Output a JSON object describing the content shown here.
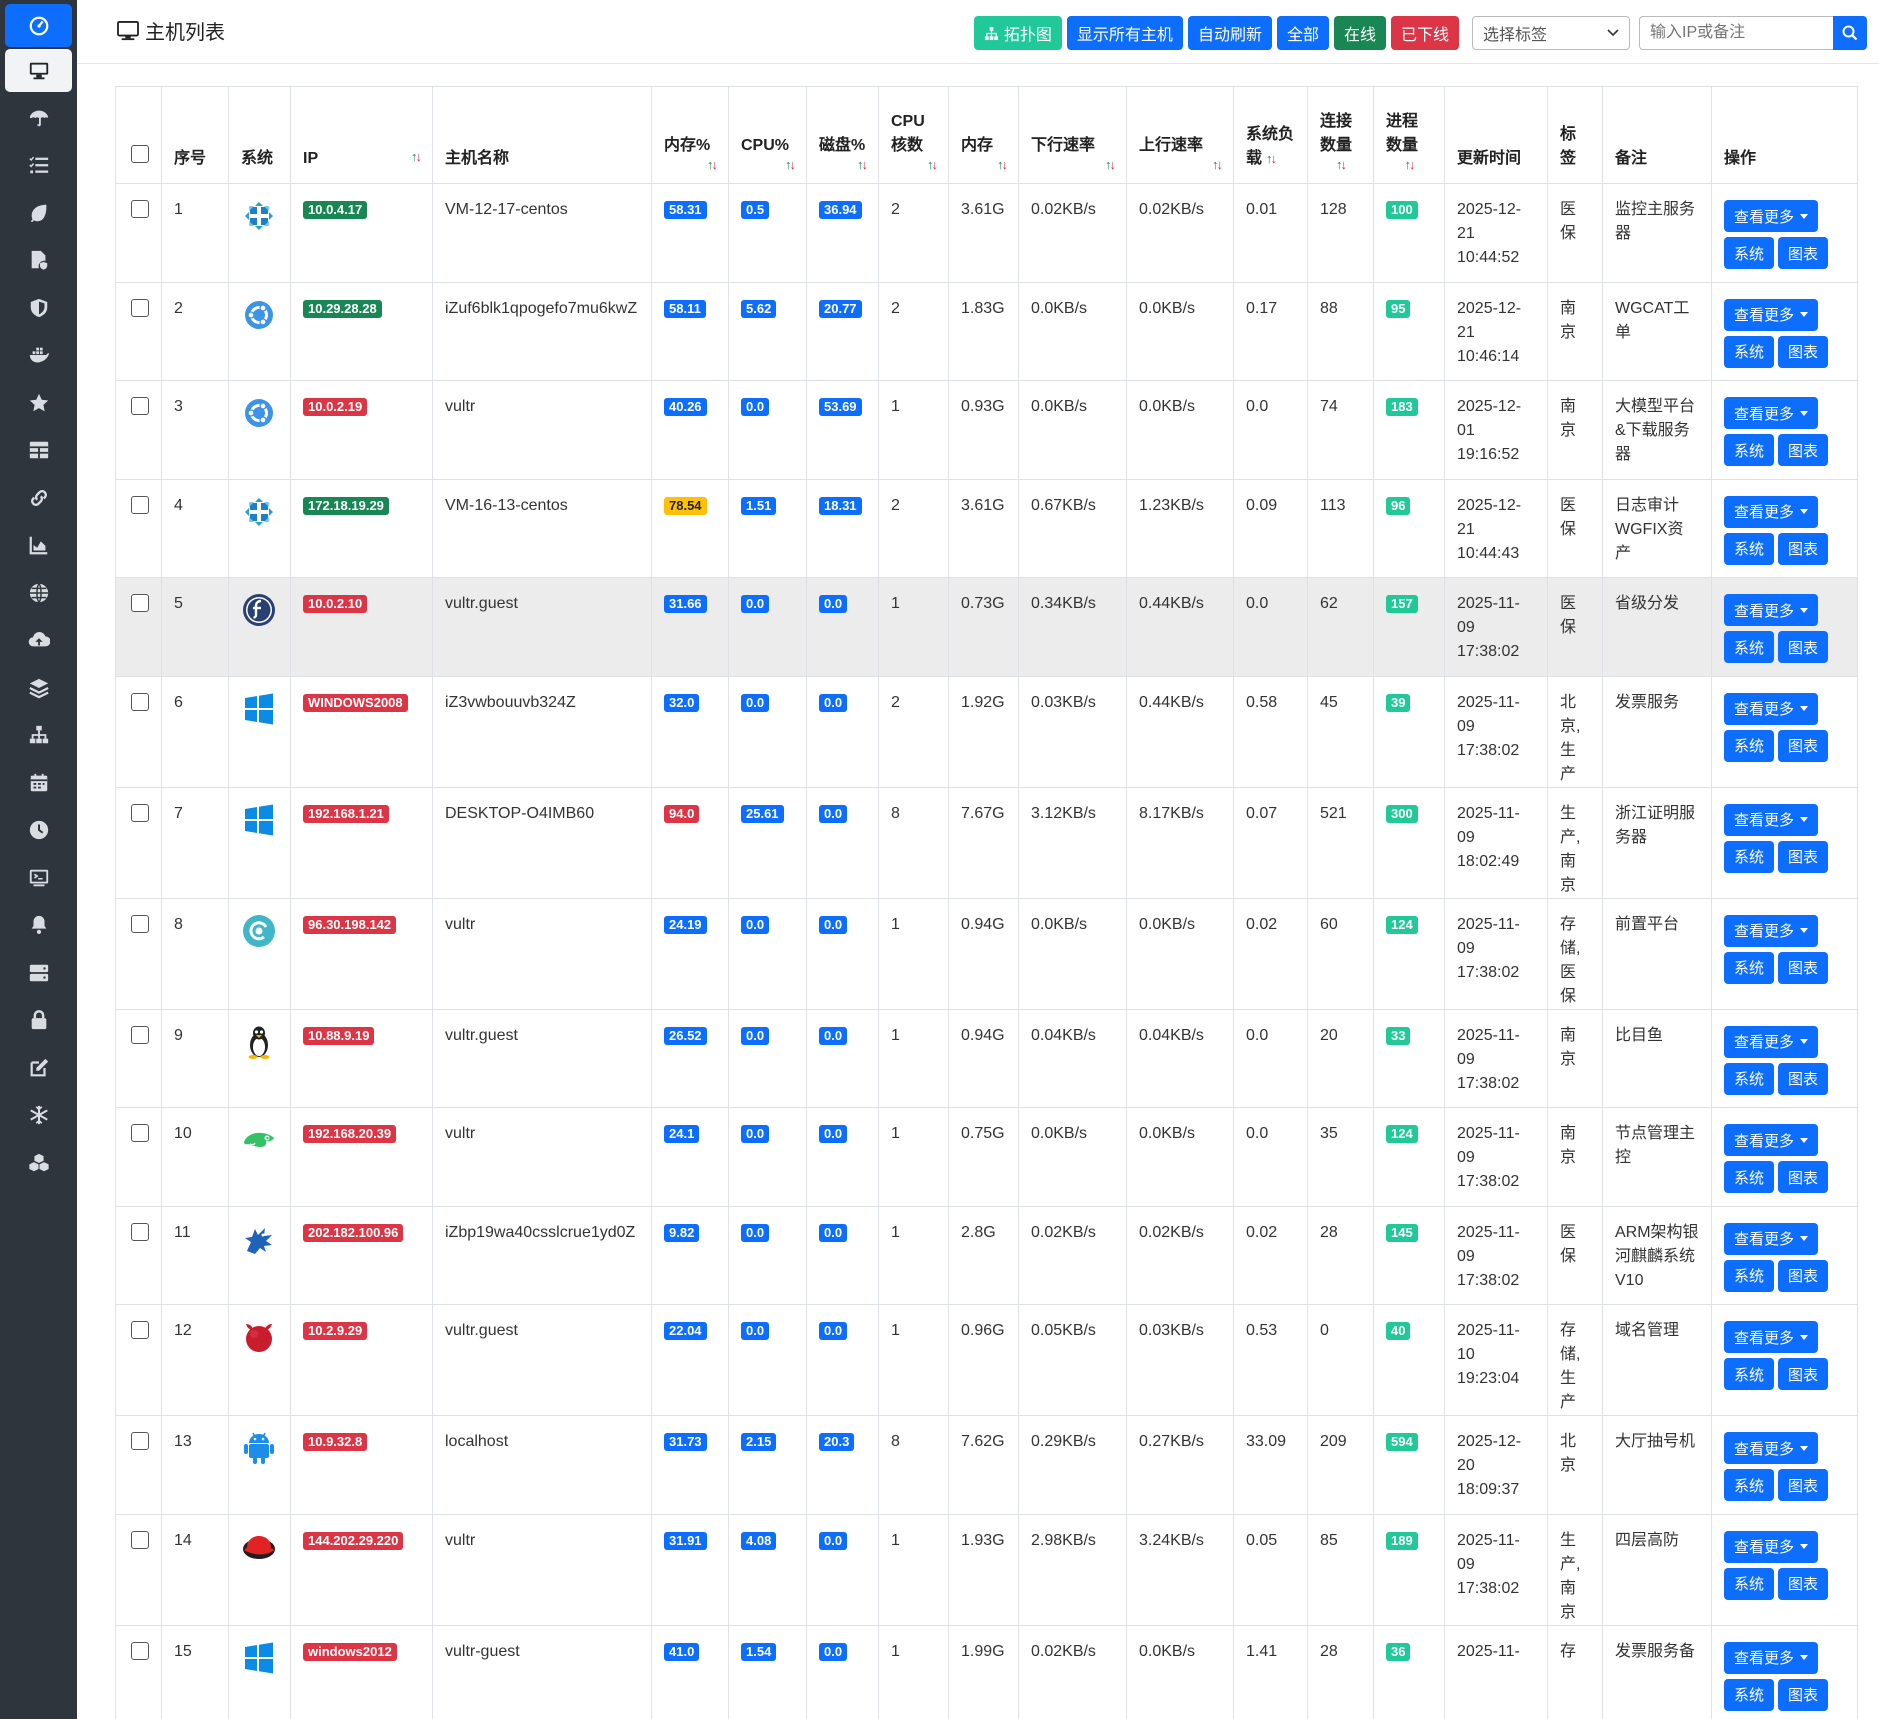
{
  "header": {
    "title": "主机列表",
    "buttons": {
      "topology": "拓扑图",
      "show_all": "显示所有主机",
      "auto_refresh": "自动刷新",
      "all": "全部",
      "online": "在线",
      "offline": "已下线"
    },
    "tag_select": "选择标签",
    "search_placeholder": "输入IP或备注"
  },
  "columns": {
    "seq": "序号",
    "os": "系统",
    "ip": "IP",
    "hostname": "主机名称",
    "mem_pct": "内存%",
    "cpu_pct": "CPU%",
    "disk_pct": "磁盘%",
    "cpu_cores": "CPU核数",
    "mem": "内存",
    "down": "下行速率",
    "up": "上行速率",
    "load": "系统负载",
    "conn": "连接数量",
    "proc": "进程数量",
    "updated": "更新时间",
    "tag": "标签",
    "remark": "备注",
    "action": "操作"
  },
  "actions": {
    "more": "查看更多",
    "system": "系统",
    "chart": "图表"
  },
  "colors": {
    "green": "#198754",
    "red": "#dc3545",
    "blue": "#0d6efd",
    "yellow": "#ffc107",
    "teal": "#20c997"
  },
  "rows": [
    {
      "seq": "1",
      "os": "centos-icon",
      "ip": "10.0.4.17",
      "ip_status": "green",
      "hostname": "VM-12-17-centos",
      "mem_pct": "58.31",
      "mem_pct_color": "blue",
      "cpu_pct": "0.5",
      "disk_pct": "36.94",
      "cores": "2",
      "mem": "3.61G",
      "down": "0.02KB/s",
      "up": "0.02KB/s",
      "load": "0.01",
      "conn": "128",
      "proc": "100",
      "updated": "2025-12-21 10:44:52",
      "tag": "医保",
      "remark": "监控主服务器"
    },
    {
      "seq": "2",
      "os": "ubuntu-icon",
      "ip": "10.29.28.28",
      "ip_status": "green",
      "hostname": "iZuf6blk1qpogefo7mu6kwZ",
      "mem_pct": "58.11",
      "mem_pct_color": "blue",
      "cpu_pct": "5.62",
      "disk_pct": "20.77",
      "cores": "2",
      "mem": "1.83G",
      "down": "0.0KB/s",
      "up": "0.0KB/s",
      "load": "0.17",
      "conn": "88",
      "proc": "95",
      "updated": "2025-12-21 10:46:14",
      "tag": "南京",
      "remark": "WGCAT工单"
    },
    {
      "seq": "3",
      "os": "ubuntu-icon",
      "ip": "10.0.2.19",
      "ip_status": "red",
      "hostname": "vultr",
      "mem_pct": "40.26",
      "mem_pct_color": "blue",
      "cpu_pct": "0.0",
      "disk_pct": "53.69",
      "cores": "1",
      "mem": "0.93G",
      "down": "0.0KB/s",
      "up": "0.0KB/s",
      "load": "0.0",
      "conn": "74",
      "proc": "183",
      "updated": "2025-12-01 19:16:52",
      "tag": "南京",
      "remark": "大模型平台&下载服务器"
    },
    {
      "seq": "4",
      "os": "centos-icon",
      "ip": "172.18.19.29",
      "ip_status": "green",
      "hostname": "VM-16-13-centos",
      "mem_pct": "78.54",
      "mem_pct_color": "yellow",
      "cpu_pct": "1.51",
      "disk_pct": "18.31",
      "cores": "2",
      "mem": "3.61G",
      "down": "0.67KB/s",
      "up": "1.23KB/s",
      "load": "0.09",
      "conn": "113",
      "proc": "96",
      "updated": "2025-12-21 10:44:43",
      "tag": "医保",
      "remark": "日志审计WGFIX资产"
    },
    {
      "seq": "5",
      "os": "fedora-icon",
      "ip": "10.0.2.10",
      "ip_status": "red",
      "hostname": "vultr.guest",
      "mem_pct": "31.66",
      "mem_pct_color": "blue",
      "cpu_pct": "0.0",
      "disk_pct": "0.0",
      "cores": "1",
      "mem": "0.73G",
      "down": "0.34KB/s",
      "up": "0.44KB/s",
      "load": "0.0",
      "conn": "62",
      "proc": "157",
      "updated": "2025-11-09 17:38:02",
      "tag": "医保",
      "remark": "省级分发"
    },
    {
      "seq": "6",
      "os": "windows-icon",
      "ip": "WINDOWS2008",
      "ip_status": "red",
      "hostname": "iZ3vwbouuvb324Z",
      "mem_pct": "32.0",
      "mem_pct_color": "blue",
      "cpu_pct": "0.0",
      "disk_pct": "0.0",
      "cores": "2",
      "mem": "1.92G",
      "down": "0.03KB/s",
      "up": "0.44KB/s",
      "load": "0.58",
      "conn": "45",
      "proc": "39",
      "updated": "2025-11-09 17:38:02",
      "tag": "北京,生产",
      "remark": "发票服务"
    },
    {
      "seq": "7",
      "os": "windows-icon",
      "ip": "192.168.1.21",
      "ip_status": "red",
      "hostname": "DESKTOP-O4IMB60",
      "mem_pct": "94.0",
      "mem_pct_color": "red",
      "cpu_pct": "25.61",
      "disk_pct": "0.0",
      "cores": "8",
      "mem": "7.67G",
      "down": "3.12KB/s",
      "up": "8.17KB/s",
      "load": "0.07",
      "conn": "521",
      "proc": "300",
      "updated": "2025-11-09 18:02:49",
      "tag": "生产,南京",
      "remark": "浙江证明服务器"
    },
    {
      "seq": "8",
      "os": "debian-icon",
      "ip": "96.30.198.142",
      "ip_status": "red",
      "hostname": "vultr",
      "mem_pct": "24.19",
      "mem_pct_color": "blue",
      "cpu_pct": "0.0",
      "disk_pct": "0.0",
      "cores": "1",
      "mem": "0.94G",
      "down": "0.0KB/s",
      "up": "0.0KB/s",
      "load": "0.02",
      "conn": "60",
      "proc": "124",
      "updated": "2025-11-09 17:38:02",
      "tag": "存储,医保",
      "remark": "前置平台"
    },
    {
      "seq": "9",
      "os": "linux-tux-icon",
      "ip": "10.88.9.19",
      "ip_status": "red",
      "hostname": "vultr.guest",
      "mem_pct": "26.52",
      "mem_pct_color": "blue",
      "cpu_pct": "0.0",
      "disk_pct": "0.0",
      "cores": "1",
      "mem": "0.94G",
      "down": "0.04KB/s",
      "up": "0.04KB/s",
      "load": "0.0",
      "conn": "20",
      "proc": "33",
      "updated": "2025-11-09 17:38:02",
      "tag": "南京",
      "remark": "比目鱼"
    },
    {
      "seq": "10",
      "os": "opensuse-icon",
      "ip": "192.168.20.39",
      "ip_status": "red",
      "hostname": "vultr",
      "mem_pct": "24.1",
      "mem_pct_color": "blue",
      "cpu_pct": "0.0",
      "disk_pct": "0.0",
      "cores": "1",
      "mem": "0.75G",
      "down": "0.0KB/s",
      "up": "0.0KB/s",
      "load": "0.0",
      "conn": "35",
      "proc": "124",
      "updated": "2025-11-09 17:38:02",
      "tag": "南京",
      "remark": "节点管理主控"
    },
    {
      "seq": "11",
      "os": "kylin-icon",
      "ip": "202.182.100.96",
      "ip_status": "red",
      "hostname": "iZbp19wa40csslcrue1yd0Z",
      "mem_pct": "9.82",
      "mem_pct_color": "blue",
      "cpu_pct": "0.0",
      "disk_pct": "0.0",
      "cores": "1",
      "mem": "2.8G",
      "down": "0.02KB/s",
      "up": "0.02KB/s",
      "load": "0.02",
      "conn": "28",
      "proc": "145",
      "updated": "2025-11-09 17:38:02",
      "tag": "医保",
      "remark": "ARM架构银河麒麟系统V10"
    },
    {
      "seq": "12",
      "os": "freebsd-icon",
      "ip": "10.2.9.29",
      "ip_status": "red",
      "hostname": "vultr.guest",
      "mem_pct": "22.04",
      "mem_pct_color": "blue",
      "cpu_pct": "0.0",
      "disk_pct": "0.0",
      "cores": "1",
      "mem": "0.96G",
      "down": "0.05KB/s",
      "up": "0.03KB/s",
      "load": "0.53",
      "conn": "0",
      "proc": "40",
      "updated": "2025-11-10 19:23:04",
      "tag": "存储,生产",
      "remark": "域名管理"
    },
    {
      "seq": "13",
      "os": "android-icon",
      "ip": "10.9.32.8",
      "ip_status": "red",
      "hostname": "localhost",
      "mem_pct": "31.73",
      "mem_pct_color": "blue",
      "cpu_pct": "2.15",
      "disk_pct": "20.3",
      "cores": "8",
      "mem": "7.62G",
      "down": "0.29KB/s",
      "up": "0.27KB/s",
      "load": "33.09",
      "conn": "209",
      "proc": "594",
      "updated": "2025-12-20 18:09:37",
      "tag": "北京",
      "remark": "大厅抽号机"
    },
    {
      "seq": "14",
      "os": "redhat-icon",
      "ip": "144.202.29.220",
      "ip_status": "red",
      "hostname": "vultr",
      "mem_pct": "31.91",
      "mem_pct_color": "blue",
      "cpu_pct": "4.08",
      "disk_pct": "0.0",
      "cores": "1",
      "mem": "1.93G",
      "down": "2.98KB/s",
      "up": "3.24KB/s",
      "load": "0.05",
      "conn": "85",
      "proc": "189",
      "updated": "2025-11-09 17:38:02",
      "tag": "生产,南京",
      "remark": "四层高防"
    },
    {
      "seq": "15",
      "os": "windows-icon",
      "ip": "windows2012",
      "ip_status": "red",
      "hostname": "vultr-guest",
      "mem_pct": "41.0",
      "mem_pct_color": "blue",
      "cpu_pct": "1.54",
      "disk_pct": "0.0",
      "cores": "1",
      "mem": "1.99G",
      "down": "0.02KB/s",
      "up": "0.0KB/s",
      "load": "1.41",
      "conn": "28",
      "proc": "36",
      "updated": "2025-11-",
      "tag": "存",
      "remark": "发票服务备"
    }
  ],
  "highlighted_row": "5",
  "sidebar": {
    "items": [
      "dashboard-icon",
      "desktop-icon",
      "umbrella-icon",
      "list-icon",
      "leaf-icon",
      "file-shield-icon",
      "shield-icon",
      "docker-icon",
      "star-icon",
      "table-icon",
      "link-icon",
      "area-chart-icon",
      "globe-icon",
      "cloud-upload-icon",
      "layers-icon",
      "sitemap-icon",
      "calendar-icon",
      "clock-icon",
      "terminal-icon",
      "bell-icon",
      "server-icon",
      "lock-icon",
      "edit-icon",
      "snowflake-icon",
      "cubes-icon"
    ]
  }
}
